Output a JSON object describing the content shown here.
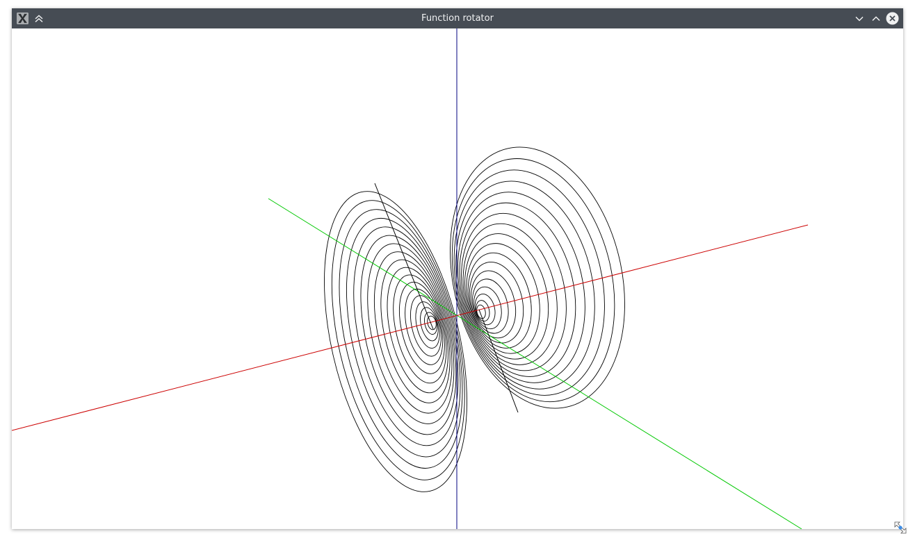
{
  "window": {
    "title": "Function rotator"
  },
  "titlebar": {
    "app_icon": "x-window-icon",
    "keep_above_icon": "double-chevron-up-icon",
    "minimize_icon": "chevron-down-icon",
    "maximize_icon": "chevron-up-icon",
    "close_icon": "close-circle-icon"
  },
  "plot": {
    "axis_colors": {
      "x": "#cc0000",
      "y": "#00c800",
      "z": "#000080"
    },
    "contour_color": "#000000",
    "contour_rings_per_lobe": 18,
    "lobes": 2
  },
  "colors": {
    "titlebar_bg": "#464c54",
    "titlebar_text": "#eff0f1",
    "canvas_bg": "#ffffff"
  }
}
